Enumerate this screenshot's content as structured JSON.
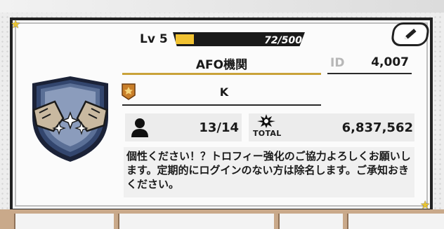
{
  "level": {
    "label": "Lv 5",
    "exp_text": "72/500",
    "exp_fraction": 0.144
  },
  "club": {
    "name": "AFO機関",
    "id_label": "ID",
    "id_value": "4,007",
    "leader_name": "K",
    "members": "13/14",
    "total_label": "TOTAL",
    "total_value": "6,837,562",
    "description": "個性ください！？トロフィー強化のご協力よろしくお願いします。定期的にログインのない方は除名します。ご承知おきください。"
  },
  "colors": {
    "accent": "#f1c232",
    "border": "#222222",
    "emblem": "#2f3f63"
  },
  "icons": {
    "edit": "pencil-icon",
    "emblem": "club-emblem-icon",
    "leader": "leader-rank-icon",
    "member": "person-icon",
    "total": "trophy-burst-icon",
    "corner": "star-icon"
  }
}
